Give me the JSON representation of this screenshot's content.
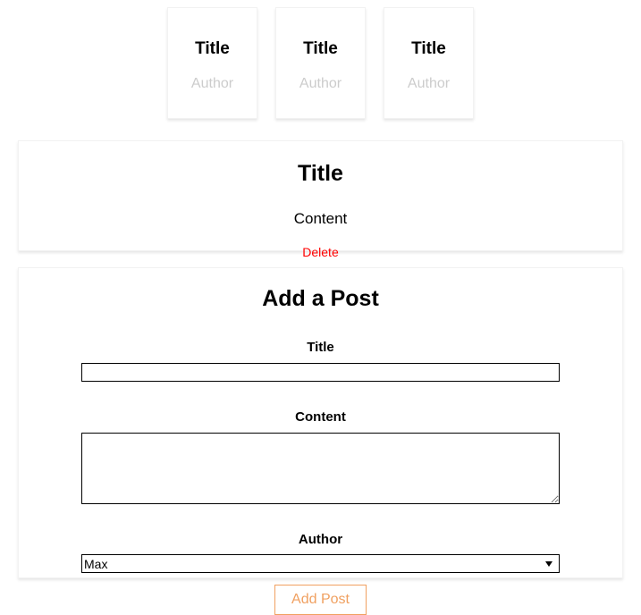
{
  "post_cards": [
    {
      "title": "Title",
      "author": "Author"
    },
    {
      "title": "Title",
      "author": "Author"
    },
    {
      "title": "Title",
      "author": "Author"
    }
  ],
  "selected_post": {
    "title": "Title",
    "content": "Content",
    "delete_label": "Delete"
  },
  "form": {
    "heading": "Add a Post",
    "title_label": "Title",
    "title_value": "",
    "content_label": "Content",
    "content_value": "",
    "author_label": "Author",
    "author_selected": "Max",
    "author_options": [
      "Max"
    ],
    "submit_label": "Add Post"
  },
  "colors": {
    "delete": "#ff0000",
    "accent": "#f0a060",
    "author_muted": "#cccccc",
    "card_border": "#f2f2f2",
    "field_border": "#000000"
  }
}
